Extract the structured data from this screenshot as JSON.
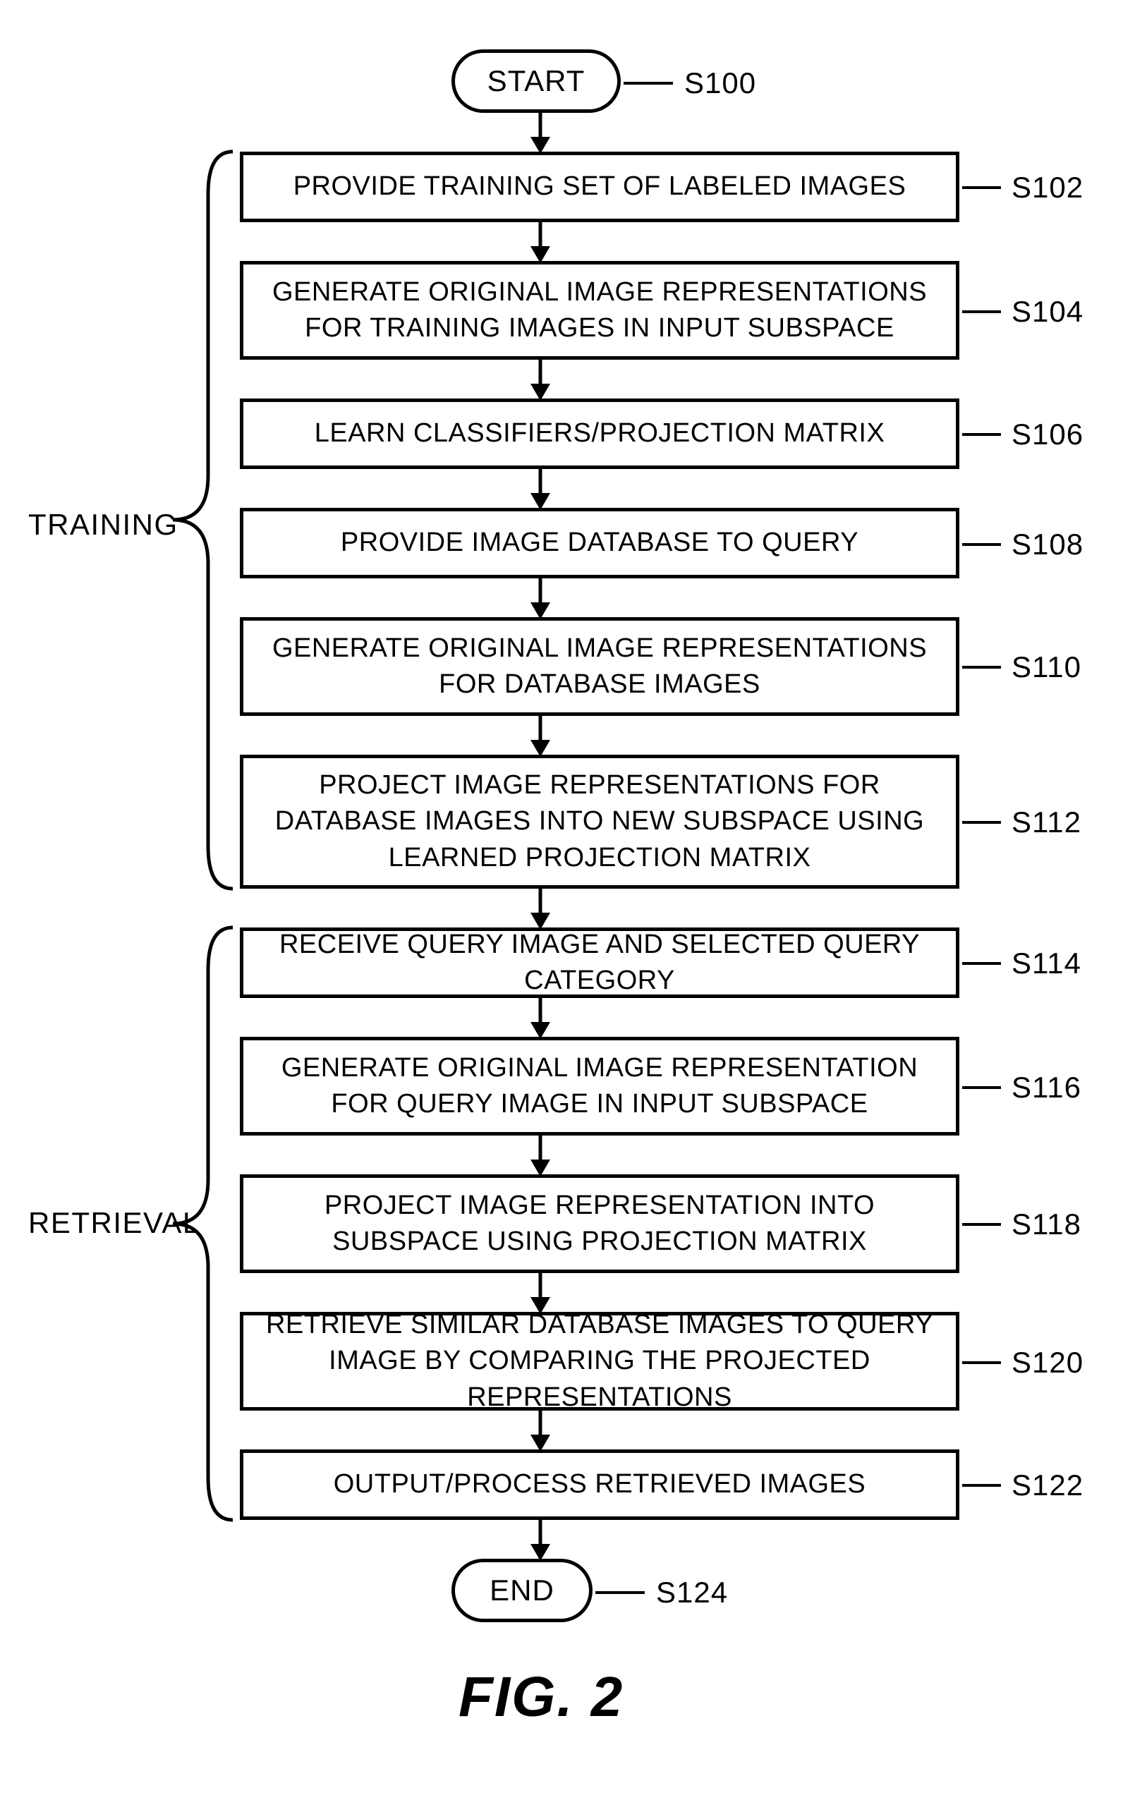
{
  "start": {
    "label": "START",
    "ref": "S100"
  },
  "end": {
    "label": "END",
    "ref": "S124"
  },
  "steps": [
    {
      "ref": "S102",
      "text": "PROVIDE TRAINING SET OF LABELED IMAGES"
    },
    {
      "ref": "S104",
      "text": "GENERATE ORIGINAL IMAGE REPRESENTATIONS FOR TRAINING IMAGES IN INPUT SUBSPACE"
    },
    {
      "ref": "S106",
      "text": "LEARN CLASSIFIERS/PROJECTION MATRIX"
    },
    {
      "ref": "S108",
      "text": "PROVIDE IMAGE DATABASE TO QUERY"
    },
    {
      "ref": "S110",
      "text": "GENERATE ORIGINAL IMAGE REPRESENTATIONS FOR DATABASE IMAGES"
    },
    {
      "ref": "S112",
      "text": "PROJECT IMAGE REPRESENTATIONS FOR DATABASE IMAGES INTO NEW SUBSPACE  USING LEARNED PROJECTION MATRIX"
    },
    {
      "ref": "S114",
      "text": "RECEIVE QUERY IMAGE AND SELECTED QUERY CATEGORY"
    },
    {
      "ref": "S116",
      "text": "GENERATE ORIGINAL IMAGE REPRESENTATION FOR QUERY IMAGE IN INPUT SUBSPACE"
    },
    {
      "ref": "S118",
      "text": "PROJECT IMAGE REPRESENTATION INTO SUBSPACE USING  PROJECTION MATRIX"
    },
    {
      "ref": "S120",
      "text": "RETRIEVE SIMILAR DATABASE IMAGES TO QUERY IMAGE BY COMPARING THE PROJECTED  REPRESENTATIONS"
    },
    {
      "ref": "S122",
      "text": "OUTPUT/PROCESS RETRIEVED IMAGES"
    }
  ],
  "groups": {
    "training": "TRAINING",
    "retrieval": "RETRIEVAL"
  },
  "figure_title": "FIG. 2"
}
